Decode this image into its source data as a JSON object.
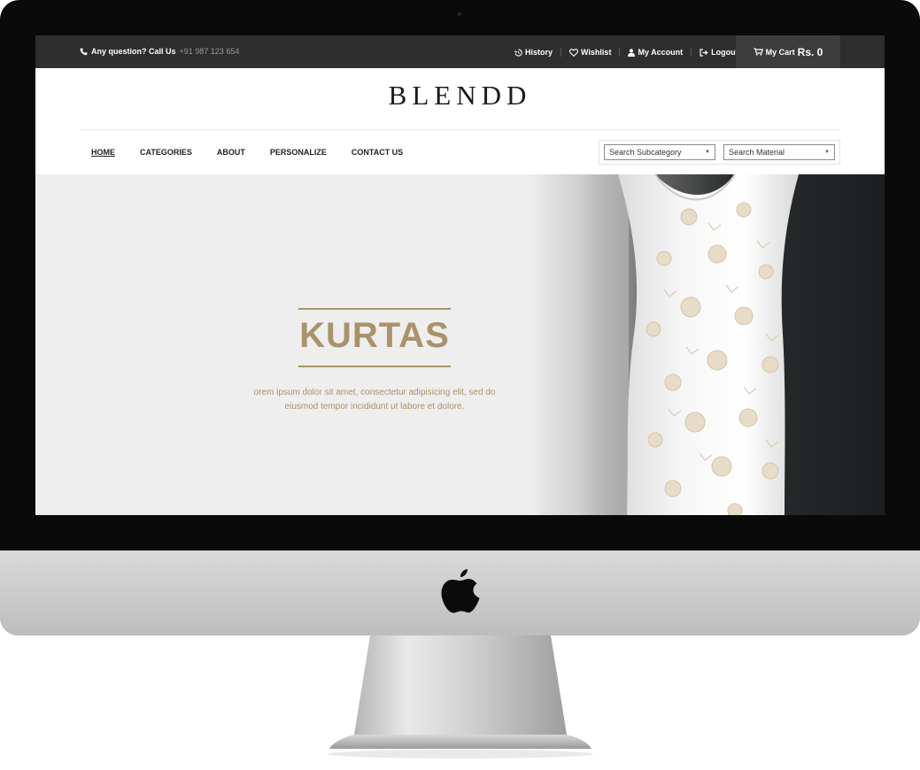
{
  "topbar": {
    "question_label": "Any question? Call Us",
    "phone_number": "+91 987 123 654",
    "links": [
      {
        "label": "History",
        "icon": "history-icon"
      },
      {
        "label": "Wishlist",
        "icon": "heart-icon"
      },
      {
        "label": "My Account",
        "icon": "user-icon"
      },
      {
        "label": "Logout",
        "icon": "logout-icon"
      }
    ],
    "cart_label": "My Cart",
    "cart_amount": "Rs. 0"
  },
  "brand": {
    "logo_text": "BLENDD"
  },
  "nav": {
    "items": [
      "HOME",
      "CATEGORIES",
      "ABOUT",
      "PERSONALIZE",
      "CONTACT US"
    ],
    "active": "HOME"
  },
  "filters": {
    "subcategory": "Search Subcategory",
    "material": "Search Material"
  },
  "hero": {
    "title": "KURTAS",
    "text_line1": "orem ipsum dolor sit amet, consectetur adipisicing elit, sed do",
    "text_line2": "eiusmod tempor incididunt ut labore et dolore."
  },
  "colors": {
    "accent_gold": "#a9936b",
    "topbar_bg": "#2e2e2e",
    "cart_bg": "#3c3c3c"
  }
}
